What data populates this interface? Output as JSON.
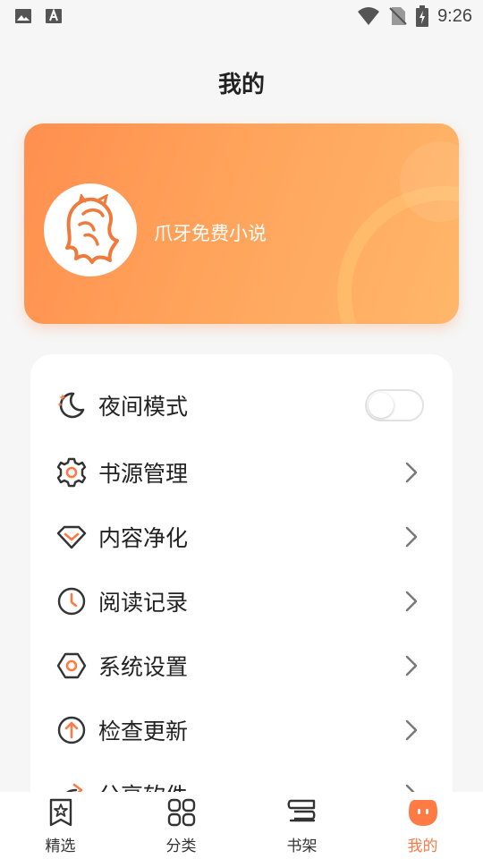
{
  "status_bar": {
    "time": "9:26",
    "left_icons": [
      "image-icon",
      "font-app-icon"
    ],
    "right_icons": [
      "wifi-icon",
      "no-sim-icon",
      "battery-charging-icon"
    ]
  },
  "page": {
    "title": "我的"
  },
  "profile": {
    "name": "爪牙免费小说",
    "avatar_icon": "lion-logo-icon"
  },
  "menu": {
    "items": [
      {
        "label": "夜间模式",
        "icon": "moon-icon",
        "control": "toggle",
        "toggle_on": false
      },
      {
        "label": "书源管理",
        "icon": "gear-icon",
        "control": "chevron"
      },
      {
        "label": "内容净化",
        "icon": "diamond-icon",
        "control": "chevron"
      },
      {
        "label": "阅读记录",
        "icon": "clock-icon",
        "control": "chevron"
      },
      {
        "label": "系统设置",
        "icon": "hexagon-settings-icon",
        "control": "chevron"
      },
      {
        "label": "检查更新",
        "icon": "arrow-up-circle-icon",
        "control": "chevron"
      },
      {
        "label": "分享软件",
        "icon": "share-icon",
        "control": "chevron"
      }
    ]
  },
  "bottom_nav": {
    "items": [
      {
        "label": "精选",
        "icon": "bookmark-star-icon",
        "active": false
      },
      {
        "label": "分类",
        "icon": "grid-icon",
        "active": false
      },
      {
        "label": "书架",
        "icon": "bookshelf-icon",
        "active": false
      },
      {
        "label": "我的",
        "icon": "profile-face-icon",
        "active": true
      }
    ]
  },
  "colors": {
    "accent": "#ff7a45",
    "card_gradient_start": "#ff8f4e",
    "card_gradient_end": "#ffb76a",
    "background": "#f6f6f6"
  }
}
